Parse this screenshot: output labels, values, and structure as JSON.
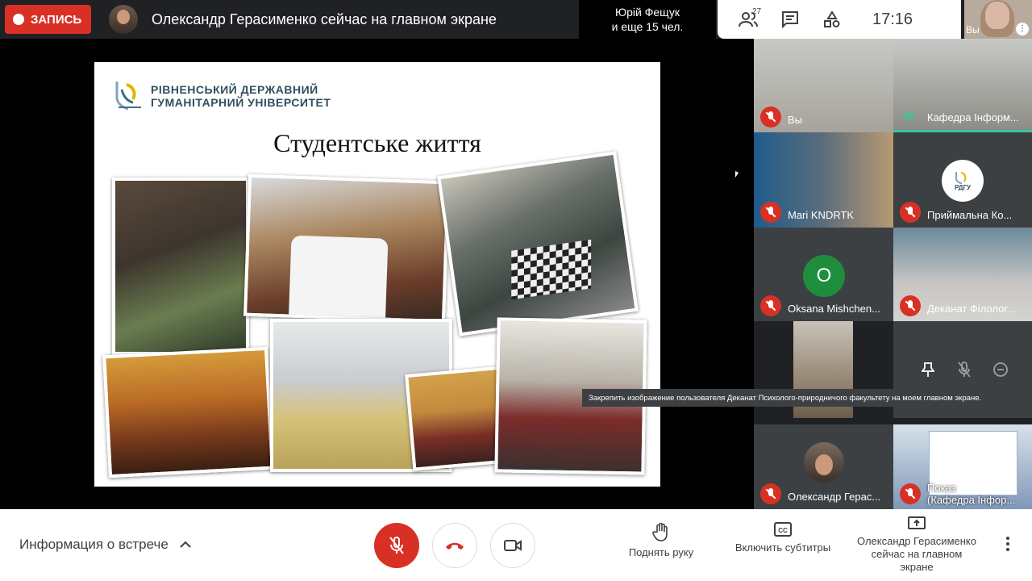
{
  "header": {
    "record_label": "ЗАПИСЬ",
    "presenter_title": "Олександр Герасименко сейчас на главном экране",
    "viewers_line1": "Юрій Фещук",
    "viewers_line2": "и еще 15 чел.",
    "participants_count": "27",
    "clock": "17:16",
    "self_label": "Вы"
  },
  "slide": {
    "university_line1": "РІВНЕНСЬКИЙ ДЕРЖАВНИЙ",
    "university_line2": "ГУМАНІТАРНИЙ УНІВЕРСИТЕТ",
    "title": "Студентське життя"
  },
  "tiles": [
    {
      "name": "Вы",
      "mic": "off"
    },
    {
      "name": "Кафедра Інформ...",
      "mic": "on"
    },
    {
      "name": "Mari KNDRTK",
      "mic": "off"
    },
    {
      "name": "Приймальна Ко...",
      "mic": "off",
      "avatar_text": "РДГУ"
    },
    {
      "name": "Oksana Mishchen...",
      "mic": "off",
      "avatar_letter": "O"
    },
    {
      "name": "Деканат Філолог...",
      "mic": "off"
    },
    {
      "name": "Олександр Герас...",
      "mic": "off"
    },
    {
      "name_line1": "Показ",
      "name_line2": "(Кафедра Інфор...",
      "mic": "off"
    }
  ],
  "tooltip": "Закрепить изображение пользователя Деканат Психолого-природничого факультету на моем главном экране.",
  "colors": {
    "accent_red": "#d93025",
    "speaking_green": "#36c7a1",
    "avatar_green": "#1e8e3e"
  },
  "bottom": {
    "meeting_info": "Информация о встрече",
    "raise_hand": "Поднять руку",
    "captions": "Включить субтитры",
    "presenting_line1": "Олександр Герасименко",
    "presenting_line2": "сейчас на главном",
    "presenting_line3": "экране"
  }
}
